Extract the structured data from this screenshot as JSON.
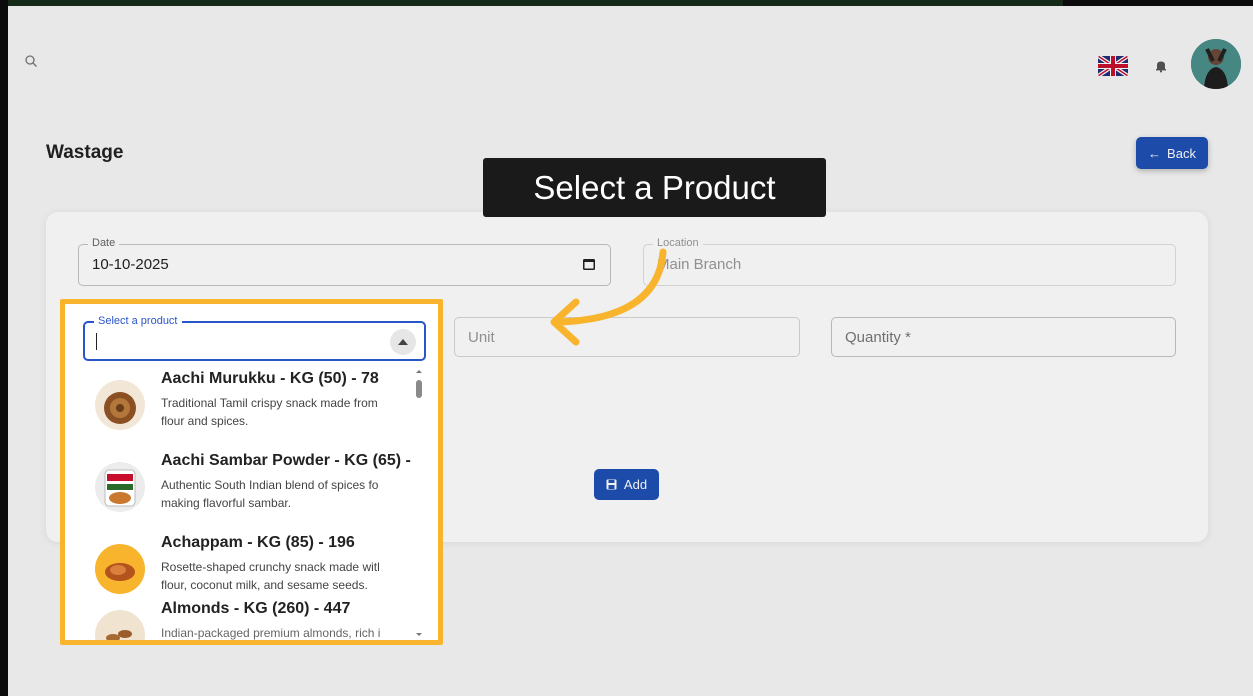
{
  "header": {
    "flag_icon": "uk-flag-icon",
    "bell_icon": "bell-icon",
    "search_icon": "search-icon"
  },
  "page": {
    "title": "Wastage",
    "back_label": "Back"
  },
  "form": {
    "date": {
      "label": "Date",
      "value": "10-10-2025"
    },
    "location": {
      "label": "Location",
      "value": "Main Branch"
    },
    "product": {
      "label": "Select a product",
      "value": ""
    },
    "unit": {
      "placeholder": "Unit"
    },
    "quantity": {
      "placeholder": "Quantity *"
    },
    "add_label": "Add"
  },
  "tooltip": "Select a Product",
  "products": [
    {
      "title": "Aachi Murukku - KG (50) - 78",
      "desc1": "Traditional Tamil crispy snack made from",
      "desc2": "flour and spices."
    },
    {
      "title": "Aachi Sambar Powder - KG (65) -",
      "desc1": "Authentic South Indian blend of spices fo",
      "desc2": "making flavorful sambar."
    },
    {
      "title": "Achappam - KG (85) - 196",
      "desc1": "Rosette-shaped crunchy snack made witl",
      "desc2": "flour, coconut milk, and sesame seeds."
    },
    {
      "title": "Almonds - KG (260) - 447",
      "desc1": "Indian-packaged premium almonds, rich i",
      "desc2": ""
    }
  ],
  "colors": {
    "accent": "#1f50b4",
    "highlight": "#f9b42d",
    "tooltip_bg": "#1a1a1a"
  }
}
